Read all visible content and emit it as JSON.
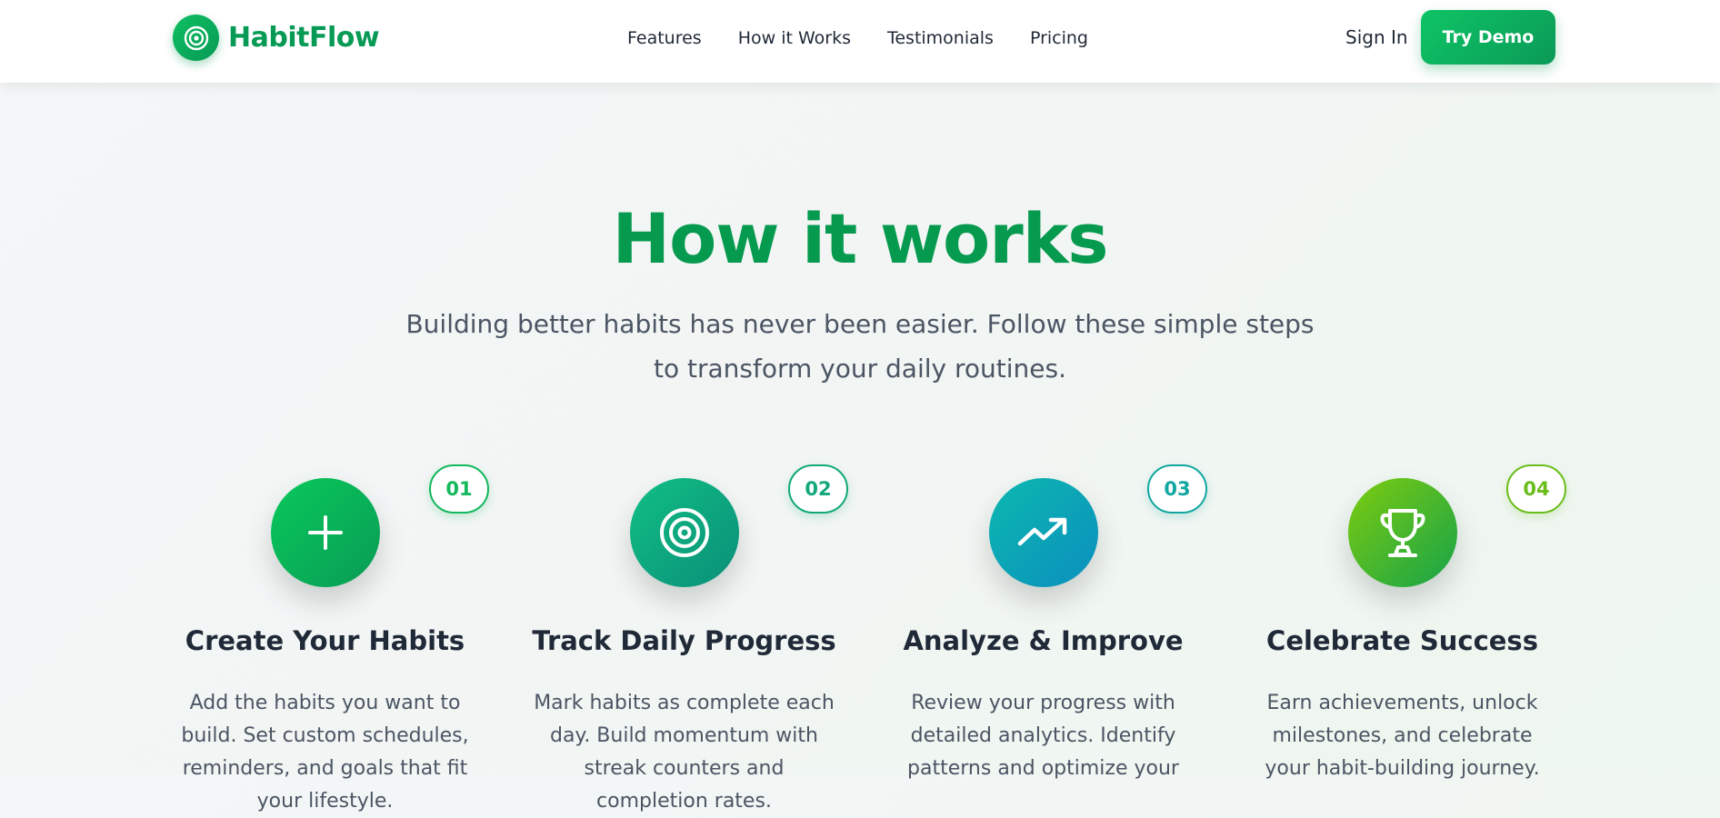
{
  "brand": {
    "name": "HabitFlow",
    "icon": "target-icon",
    "color": "#069a55"
  },
  "nav": {
    "links": [
      "Features",
      "How it Works",
      "Testimonials",
      "Pricing"
    ],
    "sign_in": "Sign In",
    "cta": "Try Demo"
  },
  "section": {
    "title": "How it works",
    "subtitle": "Building better habits has never been easier. Follow these simple steps to transform your daily routines."
  },
  "steps": [
    {
      "number": "01",
      "icon": "plus-icon",
      "title": "Create Your Habits",
      "description": "Add the habits you want to build. Set custom schedules, reminders, and goals that fit your lifestyle.",
      "gradient": [
        "#09c95b",
        "#099b55"
      ],
      "badge_color": "#14b85d"
    },
    {
      "number": "02",
      "icon": "target-icon",
      "title": "Track Daily Progress",
      "description": "Mark habits as complete each day. Build momentum with streak counters and completion rates.",
      "gradient": [
        "#10bf84",
        "#0b8f79"
      ],
      "badge_color": "#12a87a"
    },
    {
      "number": "03",
      "icon": "trending-up-icon",
      "title": "Analyze & Improve",
      "description": "Review your progress with detailed analytics. Identify patterns and optimize your",
      "gradient": [
        "#0cb8ae",
        "#0b8fbf"
      ],
      "badge_color": "#12a7a0"
    },
    {
      "number": "04",
      "icon": "trophy-icon",
      "title": "Celebrate Success",
      "description": "Earn achievements, unlock milestones, and celebrate your habit-building journey.",
      "gradient": [
        "#7dcc0e",
        "#16a34a"
      ],
      "badge_color": "#6bbd1c"
    }
  ]
}
